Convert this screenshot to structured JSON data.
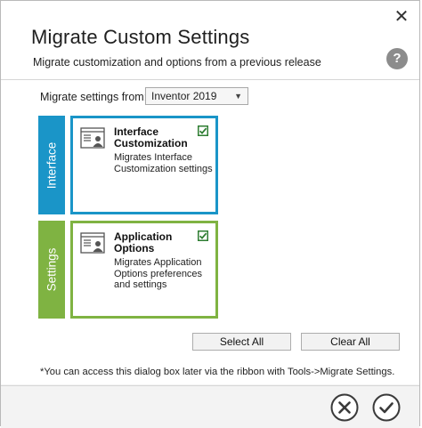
{
  "dialog": {
    "title": "Migrate Custom Settings",
    "subtitle": "Migrate customization and options from a previous release",
    "help_label": "?",
    "close_label": "✕"
  },
  "migrate_from": {
    "label": "Migrate settings from:",
    "selected": "Inventor 2019"
  },
  "groups": [
    {
      "tab_label": "Interface",
      "title": "Interface Customization",
      "description": "Migrates Interface Customization settings",
      "checked": true,
      "color": "#1a95c8"
    },
    {
      "tab_label": "Settings",
      "title": "Application Options",
      "description": "Migrates Application Options preferences and settings",
      "checked": true,
      "color": "#7fb342"
    }
  ],
  "buttons": {
    "select_all": "Select All",
    "clear_all": "Clear All"
  },
  "note": "*You can access this dialog box later via the ribbon with Tools->Migrate Settings.",
  "footer": {
    "cancel_icon": "cancel-icon",
    "ok_icon": "ok-icon"
  }
}
